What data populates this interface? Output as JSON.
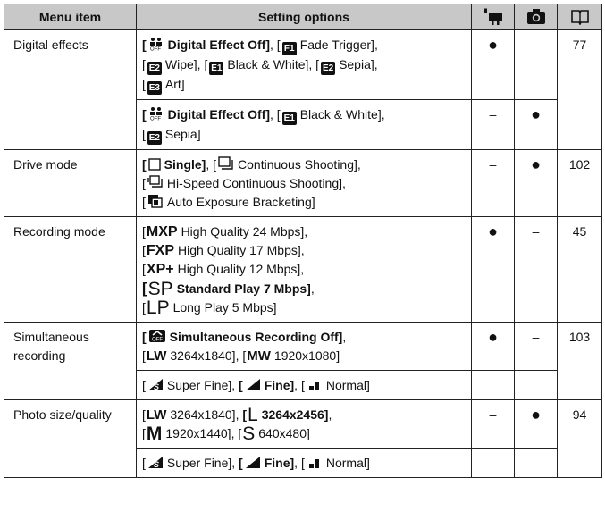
{
  "header": {
    "menu_item": "Menu item",
    "setting_options": "Setting options",
    "movie_icon": "movie-mode-icon",
    "photo_icon": "camera-icon",
    "page_icon": "book-icon"
  },
  "rows": {
    "digital_effects": {
      "name": "Digital effects",
      "a": {
        "t1": "Digital Effect Off]",
        "t2": ", [",
        "t3": "Fade Trigger],",
        "t4": "[",
        "t5": "Wipe], [",
        "t6": "Black & White], [",
        "t7": "Sepia],",
        "t8": "[",
        "t9": "Art]",
        "movie": "●",
        "photo": "–",
        "page": "77"
      },
      "b": {
        "t1": "Digital Effect Off]",
        "t2": ", [",
        "t3": "Black & White],",
        "t4": "[",
        "t5": "Sepia]",
        "movie": "–",
        "photo": "●"
      }
    },
    "drive_mode": {
      "name": "Drive mode",
      "l1a": "Single]",
      "l1b": ", [",
      "l1c": "Continuous Shooting],",
      "l2": "Hi-Speed Continuous Shooting],",
      "l3": "Auto Exposure Bracketing]",
      "movie": "–",
      "photo": "●",
      "page": "102"
    },
    "recording_mode": {
      "name": "Recording mode",
      "l1": "High Quality 24 Mbps],",
      "l2": "High Quality 17 Mbps],",
      "l3": "High Quality 12 Mbps],",
      "l4": "Standard Play 7 Mbps]",
      "l5": "Long Play 5 Mbps]",
      "g1": "MXP",
      "g2": "FXP",
      "g3": "XP+",
      "g4": "SP",
      "g5": "LP",
      "movie": "●",
      "photo": "–",
      "page": "45"
    },
    "simultaneous": {
      "name": "Simultaneous recording",
      "a1": "Simultaneous Recording Off]",
      "a2a": "LW",
      "a2b": "3264x1840], [",
      "a2c": "MW",
      "a2d": "1920x1080]",
      "b1": "Super Fine], ",
      "b2": "[",
      "b3": "Fine]",
      "b4": ", [",
      "b5": "Normal]",
      "movie": "●",
      "photo": "–",
      "page": "103"
    },
    "photo_size": {
      "name": "Photo size/quality",
      "a1": "LW",
      "a2": "3264x1840], ",
      "a3": "[",
      "a4": "L",
      "a5": "3264x2456]",
      "a6": "M",
      "a7": "1920x1440], [",
      "a8": "S",
      "a9": "640x480]",
      "b1": "Super Fine], ",
      "b2": "[",
      "b3": "Fine]",
      "b4": ", [",
      "b5": "Normal]",
      "movie": "–",
      "photo": "●",
      "page": "94"
    }
  },
  "icon_labels": {
    "e1": "E1",
    "e2": "E2",
    "e3": "E3",
    "f1": "F1",
    "w2": "E2"
  },
  "punct": {
    "lb": "[",
    "comma": ","
  }
}
